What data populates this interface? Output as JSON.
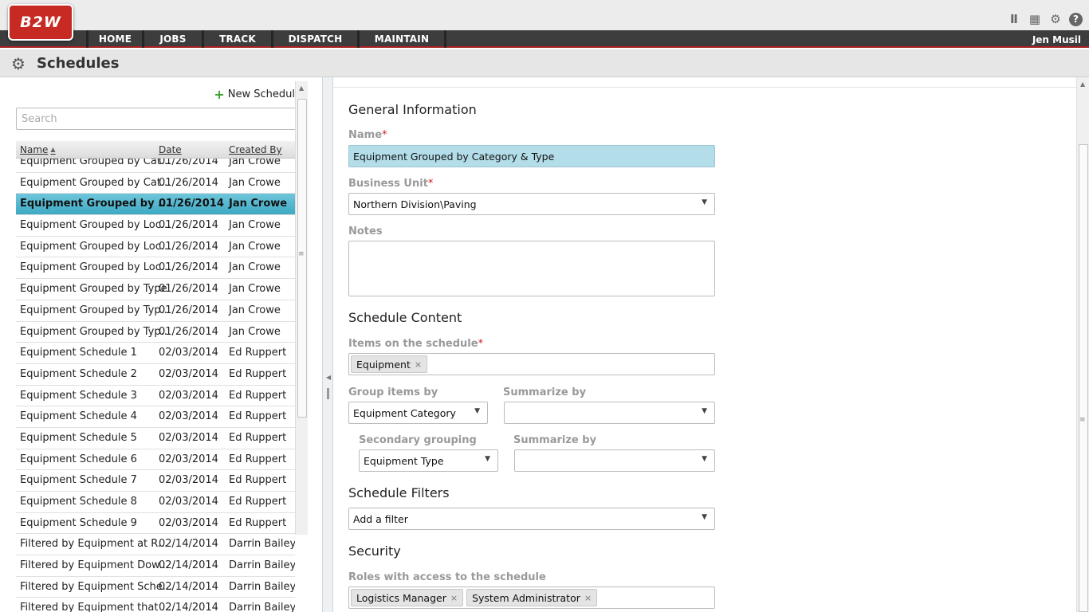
{
  "app": {
    "logo": "B2W",
    "user": "Jen Musil"
  },
  "nav": [
    {
      "label": "HOME",
      "w": 73
    },
    {
      "label": "JOBS",
      "w": 75
    },
    {
      "label": "TRACK",
      "w": 87
    },
    {
      "label": "DISPATCH",
      "w": 108
    },
    {
      "label": "MAINTAIN",
      "w": 109
    }
  ],
  "page": {
    "title": "Schedules"
  },
  "list": {
    "new_label": "New Schedule",
    "search_placeholder": "Search",
    "headers": {
      "name": "Name",
      "date": "Date",
      "created": "Created By"
    },
    "rows": [
      [
        "Equipment Grouped by Cat...",
        "01/26/2014",
        "Jan Crowe"
      ],
      [
        "Equipment Grouped by Cat...",
        "01/26/2014",
        "Jan Crowe"
      ],
      [
        "Equipment Grouped by ...",
        "01/26/2014",
        "Jan Crowe"
      ],
      [
        "Equipment Grouped by Loc...",
        "01/26/2014",
        "Jan Crowe"
      ],
      [
        "Equipment Grouped by Loc...",
        "01/26/2014",
        "Jan Crowe"
      ],
      [
        "Equipment Grouped by Loc...",
        "01/26/2014",
        "Jan Crowe"
      ],
      [
        "Equipment Grouped by Type",
        "01/26/2014",
        "Jan Crowe"
      ],
      [
        "Equipment Grouped by Typ...",
        "01/26/2014",
        "Jan Crowe"
      ],
      [
        "Equipment Grouped by Typ...",
        "01/26/2014",
        "Jan Crowe"
      ],
      [
        "Equipment Schedule 1",
        "02/03/2014",
        "Ed Ruppert"
      ],
      [
        "Equipment Schedule 2",
        "02/03/2014",
        "Ed Ruppert"
      ],
      [
        "Equipment Schedule 3",
        "02/03/2014",
        "Ed Ruppert"
      ],
      [
        "Equipment Schedule 4",
        "02/03/2014",
        "Ed Ruppert"
      ],
      [
        "Equipment Schedule 5",
        "02/03/2014",
        "Ed Ruppert"
      ],
      [
        "Equipment Schedule 6",
        "02/03/2014",
        "Ed Ruppert"
      ],
      [
        "Equipment Schedule 7",
        "02/03/2014",
        "Ed Ruppert"
      ],
      [
        "Equipment Schedule 8",
        "02/03/2014",
        "Ed Ruppert"
      ],
      [
        "Equipment Schedule 9",
        "02/03/2014",
        "Ed Ruppert"
      ],
      [
        "Filtered by Equipment at R...",
        "02/14/2014",
        "Darrin Bailey"
      ],
      [
        "Filtered by Equipment Dow...",
        "02/14/2014",
        "Darrin Bailey"
      ],
      [
        "Filtered by Equipment Sche...",
        "02/14/2014",
        "Darrin Bailey"
      ],
      [
        "Filtered by Equipment that ...",
        "02/14/2014",
        "Darrin Bailey"
      ]
    ],
    "selected_index": 2
  },
  "form": {
    "general_title": "General Information",
    "name_label": "Name",
    "name_value": "Equipment Grouped by Category & Type",
    "bu_label": "Business Unit",
    "bu_value": "Northern Division\\Paving",
    "notes_label": "Notes",
    "content_title": "Schedule Content",
    "items_label": "Items on the schedule",
    "items_tags": [
      "Equipment"
    ],
    "group_label": "Group items by",
    "group_value": "Equipment Category",
    "summarize_label": "Summarize by",
    "summarize_value": "",
    "secondary_label": "Secondary grouping",
    "secondary_value": "Equipment Type",
    "summarize2_label": "Summarize by",
    "summarize2_value": "",
    "filters_title": "Schedule Filters",
    "filter_value": "Add a filter",
    "security_title": "Security",
    "roles_label": "Roles with access to the schedule",
    "roles_tags": [
      "Logistics Manager",
      "System Administrator"
    ]
  },
  "icons": [
    "library-icon",
    "chart-icon",
    "gear-icon",
    "help-icon",
    "plus-icon",
    "dropdown-arrow-icon",
    "remove-tag-icon"
  ],
  "colors": {
    "brand": "#c62a22",
    "nav": "#3d3d3d",
    "selected_row": "#3ea9c4",
    "highlight_field": "#b3dde8",
    "add_green": "#3aa32f",
    "required": "#c62222"
  }
}
